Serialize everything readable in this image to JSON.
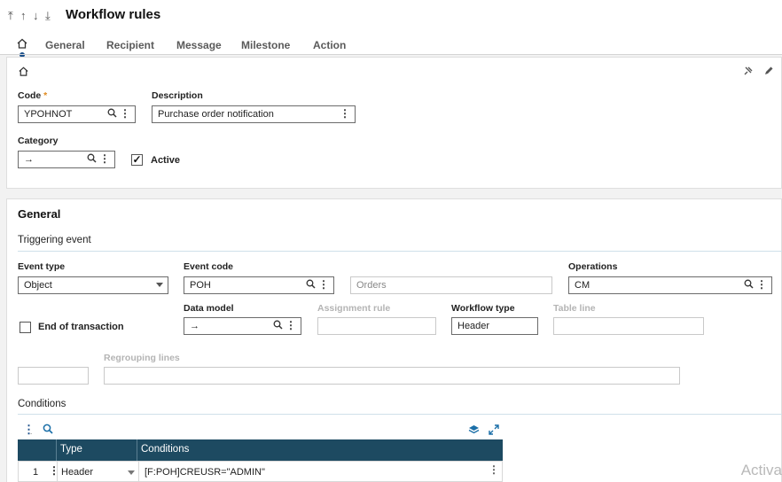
{
  "header": {
    "nav": [
      "⤒",
      "↑",
      "↓",
      "⤓"
    ],
    "title": "Workflow rules"
  },
  "tabs": [
    {
      "label": "General"
    },
    {
      "label": "Recipient"
    },
    {
      "label": "Message"
    },
    {
      "label": "Milestone"
    },
    {
      "label": "Action"
    }
  ],
  "card1": {
    "code_label": "Code",
    "code_required": "*",
    "code_value": "YPOHNOT",
    "description_label": "Description",
    "description_value": "Purchase order notification",
    "category_label": "Category",
    "category_value": "→",
    "active_label": "Active",
    "active_checked": true
  },
  "general": {
    "title": "General",
    "triggering_event": "Triggering event",
    "event_type_label": "Event type",
    "event_type_value": "Object",
    "event_code_label": "Event code",
    "event_code_value": "POH",
    "event_desc_value": "Orders",
    "operations_label": "Operations",
    "operations_value": "CM",
    "end_of_transaction_label": "End of transaction",
    "data_model_label": "Data model",
    "data_model_value": "→",
    "assignment_rule_label": "Assignment rule",
    "workflow_type_label": "Workflow type",
    "workflow_type_value": "Header",
    "table_line_label": "Table line",
    "regrouping_label": "Regrouping lines"
  },
  "conditions": {
    "title": "Conditions",
    "columns": [
      "Type",
      "Conditions"
    ],
    "rows": [
      {
        "num": "1",
        "type": "Header",
        "condition": "[F:POH]CREUSR=\"ADMIN\""
      }
    ]
  },
  "watermark": "Activa",
  "colors": {
    "accent": "#1b4f8a",
    "grid_header": "#1d4a61",
    "required": "#e08a1e"
  }
}
